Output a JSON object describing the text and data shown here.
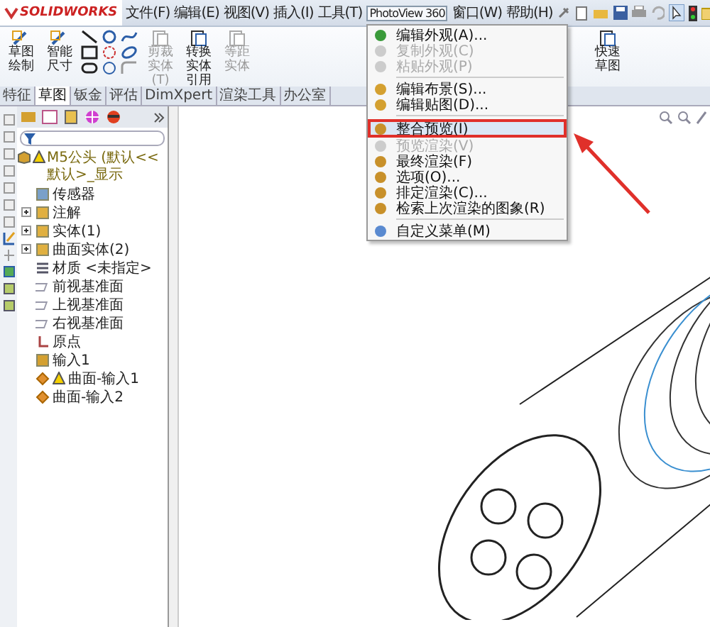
{
  "app": {
    "logo": "SOLIDWORKS"
  },
  "menubar": [
    {
      "label": "文件(F)",
      "selected": false
    },
    {
      "label": "编辑(E)",
      "selected": false
    },
    {
      "label": "视图(V)",
      "selected": false
    },
    {
      "label": "插入(I)",
      "selected": false
    },
    {
      "label": "工具(T)",
      "selected": false
    },
    {
      "label": "PhotoView 360",
      "selected": true
    },
    {
      "label": "窗口(W)",
      "selected": false
    },
    {
      "label": "帮助(H)",
      "selected": false
    }
  ],
  "ribbon": [
    {
      "label": "草图绘制",
      "disabled": false
    },
    {
      "label": "智能尺寸",
      "disabled": false
    },
    {
      "label": "剪裁实体(T)",
      "disabled": true
    },
    {
      "label": "转换实体引用",
      "disabled": false
    },
    {
      "label": "等距实体",
      "disabled": true
    },
    {
      "label": "快速草图",
      "disabled": false
    }
  ],
  "tabs": [
    {
      "label": "特征",
      "selected": false
    },
    {
      "label": "草图",
      "selected": true
    },
    {
      "label": "钣金",
      "selected": false
    },
    {
      "label": "评估",
      "selected": false
    },
    {
      "label": "DimXpert",
      "selected": false
    },
    {
      "label": "渲染工具",
      "selected": false
    },
    {
      "label": "办公室",
      "selected": false
    }
  ],
  "tree": {
    "label": "M5公头 (默认<<默认>_显示",
    "warning": true,
    "children": [
      {
        "label": "传感器",
        "kind": "sensor",
        "expander": false,
        "warning": false
      },
      {
        "label": "注解",
        "kind": "annotation",
        "expander": true,
        "warning": false
      },
      {
        "label": "实体(1)",
        "kind": "folder",
        "expander": true,
        "warning": false
      },
      {
        "label": "曲面实体(2)",
        "kind": "surface-folder",
        "expander": true,
        "warning": false
      },
      {
        "label": "材质 <未指定>",
        "kind": "material",
        "expander": false,
        "warning": false
      },
      {
        "label": "前视基准面",
        "kind": "plane",
        "expander": false,
        "warning": false
      },
      {
        "label": "上视基准面",
        "kind": "plane",
        "expander": false,
        "warning": false
      },
      {
        "label": "右视基准面",
        "kind": "plane",
        "expander": false,
        "warning": false
      },
      {
        "label": "原点",
        "kind": "origin",
        "expander": false,
        "warning": false
      },
      {
        "label": "输入1",
        "kind": "import",
        "expander": false,
        "warning": false
      },
      {
        "label": "曲面-输入1",
        "kind": "surface",
        "expander": false,
        "warning": true
      },
      {
        "label": "曲面-输入2",
        "kind": "surface",
        "expander": false,
        "warning": false
      }
    ]
  },
  "menu": {
    "groups": [
      [
        {
          "label": "编辑外观(A)...",
          "disabled": false,
          "selected": false
        },
        {
          "label": "复制外观(C)",
          "disabled": true,
          "selected": false
        },
        {
          "label": "粘贴外观(P)",
          "disabled": true,
          "selected": false
        }
      ],
      [
        {
          "label": "编辑布景(S)...",
          "disabled": false,
          "selected": false
        },
        {
          "label": "编辑贴图(D)...",
          "disabled": false,
          "selected": false
        }
      ],
      [
        {
          "label": "整合预览(I)",
          "disabled": false,
          "selected": true
        },
        {
          "label": "预览渲染(V)",
          "disabled": true,
          "selected": false
        },
        {
          "label": "最终渲染(F)",
          "disabled": false,
          "selected": false
        },
        {
          "label": "选项(O)...",
          "disabled": false,
          "selected": false
        },
        {
          "label": "排定渲染(C)...",
          "disabled": false,
          "selected": false
        },
        {
          "label": "检索上次渲染的图象(R)",
          "disabled": false,
          "selected": false
        }
      ],
      [
        {
          "label": "自定义菜单(M)",
          "disabled": false,
          "selected": false
        }
      ]
    ]
  }
}
